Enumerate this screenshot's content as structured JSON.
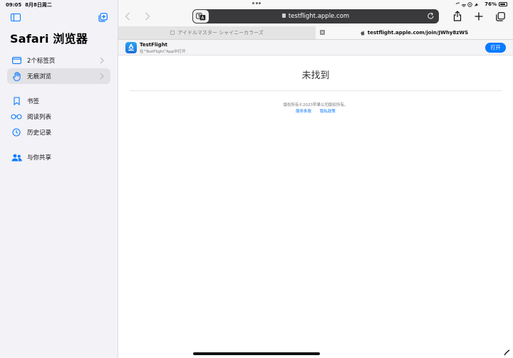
{
  "status_bar": {
    "time": "09:05",
    "date": "8月8日周二",
    "battery": "76%"
  },
  "sidebar": {
    "title": "Safari 浏览器",
    "items": [
      {
        "label": "2个标签页",
        "icon": "tabs-icon"
      },
      {
        "label": "无痕浏览",
        "icon": "hand-icon",
        "active": true
      },
      {
        "label": "书签",
        "icon": "bookmark-icon"
      },
      {
        "label": "阅读列表",
        "icon": "glasses-icon"
      },
      {
        "label": "历史记录",
        "icon": "clock-icon"
      },
      {
        "label": "与你共享",
        "icon": "people-icon"
      }
    ]
  },
  "toolbar": {
    "address": "testflight.apple.com"
  },
  "tabs": [
    {
      "title": "アイドルマスター シャイニーカラーズ"
    },
    {
      "title": "testflight.apple.com/join/JWhy8zWS"
    }
  ],
  "banner": {
    "app_name": "TestFlight",
    "subtitle": "在“TestFlight”App中打开",
    "open_label": "打开"
  },
  "page": {
    "title": "未找到",
    "copyright": "版权所有©2023苹果公司版权所有。",
    "links": [
      "服务条款",
      "隐私政策"
    ]
  },
  "colors": {
    "accent": "#0a7aff",
    "sidebar_bg": "#f2f2f7",
    "address_bg": "#3a3a3c"
  }
}
